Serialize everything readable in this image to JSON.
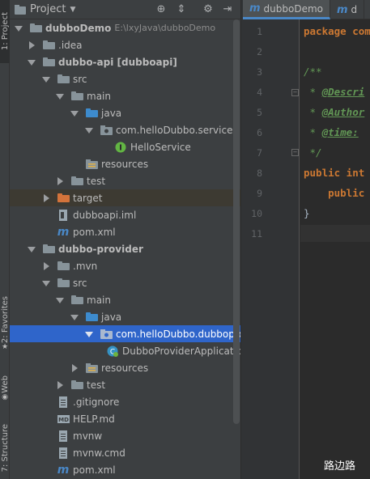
{
  "side_tabs": {
    "project": "1: Project",
    "favorites": "2: Favorites",
    "web": "Web",
    "structure": "7: Structure"
  },
  "project_panel": {
    "title": "Project",
    "tree": [
      {
        "label": "dubboDemo",
        "extra": "E:\\lxyJava\\dubboDemo",
        "bold": true
      },
      {
        "label": ".idea"
      },
      {
        "label": "dubbo-api [dubboapi]",
        "bold": true
      },
      {
        "label": "src"
      },
      {
        "label": "main"
      },
      {
        "label": "java"
      },
      {
        "label": "com.helloDubbo.service"
      },
      {
        "label": "HelloService"
      },
      {
        "label": "resources"
      },
      {
        "label": "test"
      },
      {
        "label": "target"
      },
      {
        "label": "dubboapi.iml"
      },
      {
        "label": "pom.xml"
      },
      {
        "label": "dubbo-provider",
        "bold": true
      },
      {
        "label": ".mvn"
      },
      {
        "label": "src"
      },
      {
        "label": "main"
      },
      {
        "label": "java"
      },
      {
        "label": "com.helloDubbo.dubboprovider"
      },
      {
        "label": "DubboProviderApplication"
      },
      {
        "label": "resources"
      },
      {
        "label": "test"
      },
      {
        "label": ".gitignore"
      },
      {
        "label": "HELP.md"
      },
      {
        "label": "mvnw"
      },
      {
        "label": "mvnw.cmd"
      },
      {
        "label": "pom.xml"
      }
    ]
  },
  "editor": {
    "tabs": [
      "dubboDemo",
      "d"
    ],
    "line_numbers": [
      "1",
      "2",
      "3",
      "4",
      "5",
      "6",
      "7",
      "8",
      "9",
      "10",
      "11"
    ],
    "code": {
      "l1_kw": "package",
      "l1_rest": " com",
      "l3": "/**",
      "l4_star": " * ",
      "l4_tag": "@Descri",
      "l5_star": " * ",
      "l5_tag": "@Author",
      "l6_star": " * ",
      "l6_tag": "@time:",
      "l7": " */",
      "l8_kw": "public",
      "l8_kw2": " int",
      "l9_kw": "    public",
      "l10": "}"
    }
  },
  "watermark": "路边路"
}
